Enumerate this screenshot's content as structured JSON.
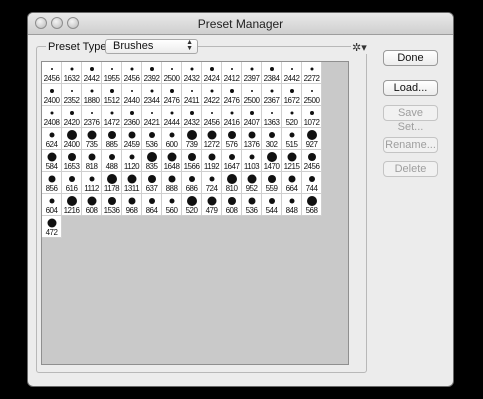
{
  "window": {
    "title": "Preset Manager"
  },
  "preset_type": {
    "label": "Preset Type:",
    "value": "Brushes"
  },
  "buttons": {
    "done": "Done",
    "load": "Load...",
    "save_set": "Save Set...",
    "rename": "Rename...",
    "delete": "Delete"
  },
  "brush_sizes": [
    "2456",
    "1632",
    "2442",
    "1955",
    "2456",
    "2392",
    "2500",
    "2432",
    "2424",
    "2412",
    "2397",
    "2384",
    "2442",
    "2272",
    "2400",
    "2352",
    "1880",
    "1512",
    "2440",
    "2344",
    "2476",
    "2411",
    "2422",
    "2476",
    "2500",
    "2367",
    "1672",
    "2500",
    "2408",
    "2420",
    "2376",
    "1472",
    "2360",
    "2421",
    "2444",
    "2432",
    "2456",
    "2416",
    "2407",
    "1363",
    "520",
    "1072",
    "624",
    "2400",
    "735",
    "885",
    "2459",
    "536",
    "600",
    "739",
    "1272",
    "576",
    "1376",
    "302",
    "515",
    "927",
    "584",
    "1653",
    "818",
    "488",
    "1120",
    "835",
    "1648",
    "1566",
    "1192",
    "1647",
    "1103",
    "1470",
    "1215",
    "2456",
    "856",
    "616",
    "1112",
    "1178",
    "1311",
    "637",
    "888",
    "686",
    "724",
    "810",
    "952",
    "559",
    "664",
    "744",
    "604",
    "1216",
    "608",
    "1536",
    "968",
    "864",
    "560",
    "520",
    "479",
    "608",
    "536",
    "544",
    "848",
    "568",
    "472"
  ]
}
